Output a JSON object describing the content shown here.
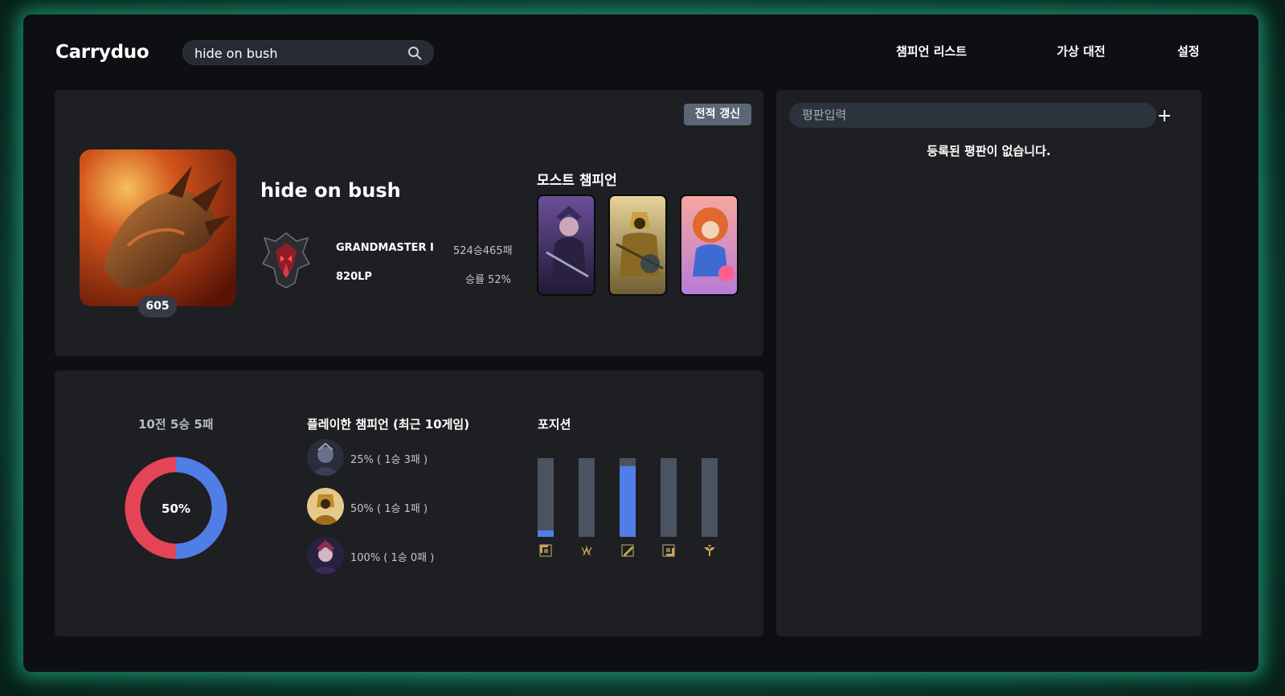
{
  "app": {
    "logo": "Carryduo"
  },
  "search": {
    "value": "hide on bush"
  },
  "nav": {
    "champion_list": "챔피언 리스트",
    "virtual_match": "가상 대전",
    "settings": "설정"
  },
  "profile": {
    "refresh_label": "전적 갱신",
    "level": "605",
    "name": "hide on bush",
    "tier": "GRANDMASTER I",
    "lp": "820LP",
    "record": "524승465패",
    "winrate": "승률 52%",
    "most_champions_title": "모스트 챔피언"
  },
  "recent": {
    "summary": "10전 5승 5패",
    "winrate_label": "50%",
    "win_ratio": 0.5,
    "played_title": "플레이한 챔피언 (최근 10게임)",
    "played": [
      {
        "text": "25% ( 1승 3패 )"
      },
      {
        "text": "50% ( 1승 1패 )"
      },
      {
        "text": "100% ( 1승 0패 )"
      }
    ],
    "position_title": "포지션",
    "positions": [
      {
        "icon": "top-lane-icon",
        "value": 0.08
      },
      {
        "icon": "jungle-icon",
        "value": 0.0
      },
      {
        "icon": "mid-lane-icon",
        "value": 0.9
      },
      {
        "icon": "bottom-lane-icon",
        "value": 0.0
      },
      {
        "icon": "support-icon",
        "value": 0.0
      }
    ]
  },
  "reviews": {
    "placeholder": "평판입력",
    "empty": "등록된 평판이 없습니다."
  },
  "colors": {
    "win": "#4f7ee6",
    "loss": "#e54457",
    "card": "#1e1f22",
    "accent_glow": "#28c896"
  }
}
